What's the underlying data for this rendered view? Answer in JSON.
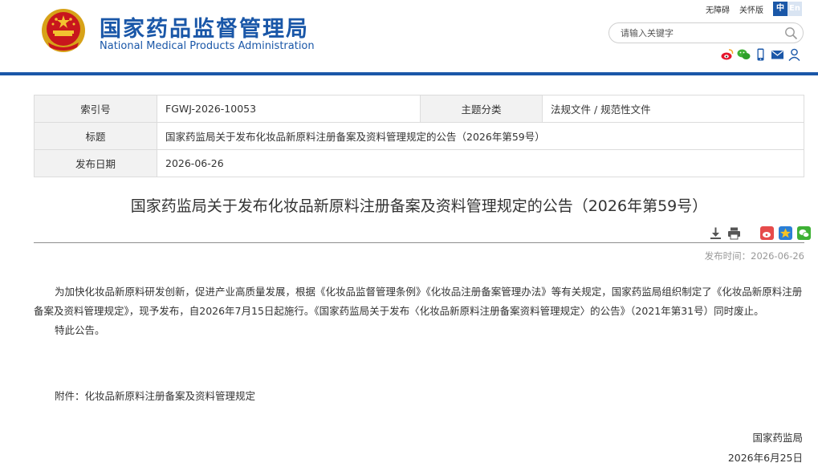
{
  "header": {
    "site_name_cn": "国家药品监督管理局",
    "site_name_en": "National Medical Products Administration",
    "accessibility_link": "无障碍",
    "care_mode_link": "关怀版",
    "lang_cn": "中",
    "lang_en": "En",
    "search_placeholder": "请输入关键字",
    "brand_color": "#1a57a8"
  },
  "meta": {
    "index_label": "索引号",
    "index_value": "FGWJ-2026-10053",
    "category_label": "主题分类",
    "category_value": "法规文件 / 规范性文件",
    "title_label": "标题",
    "title_value": "国家药监局关于发布化妆品新原料注册备案及资料管理规定的公告（2026年第59号）",
    "date_label": "发布日期",
    "date_value": "2026-06-26"
  },
  "article": {
    "title": "国家药监局关于发布化妆品新原料注册备案及资料管理规定的公告（2026年第59号）",
    "publish_time": "发布时间：2026-06-26",
    "paragraph1": "为加快化妆品新原料研发创新，促进产业高质量发展，根据《化妆品监督管理条例》《化妆品注册备案管理办法》等有关规定，国家药监局组织制定了《化妆品新原料注册备案及资料管理规定》，现予发布，自2026年7月15日起施行。《国家药监局关于发布〈化妆品新原料注册备案资料管理规定〉的公告》（2021年第31号）同时废止。",
    "paragraph2": "特此公告。",
    "attachment": "附件：化妆品新原料注册备案及资料管理规定",
    "signature": "国家药监局",
    "sign_date": "2026年6月25日"
  },
  "icons": {
    "social": [
      "weibo-icon",
      "wechat-icon",
      "mobile-icon",
      "email-icon",
      "user-icon"
    ],
    "tools": [
      "download-icon",
      "print-icon",
      "weibo-share-icon",
      "favorite-star-icon",
      "wechat-share-icon"
    ]
  }
}
